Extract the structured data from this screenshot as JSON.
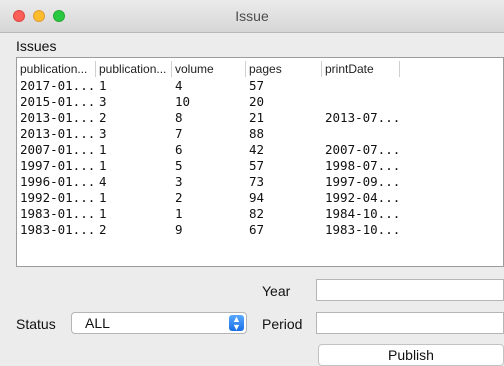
{
  "window": {
    "title": "Issue"
  },
  "section_label": "Issues",
  "table": {
    "columns": [
      "publication...",
      "publication...",
      "volume",
      "pages",
      "printDate"
    ],
    "rows": [
      [
        "2017-01...",
        "1",
        "4",
        "57",
        ""
      ],
      [
        "2015-01...",
        "3",
        "10",
        "20",
        ""
      ],
      [
        "2013-01...",
        "2",
        "8",
        "21",
        "2013-07..."
      ],
      [
        "2013-01...",
        "3",
        "7",
        "88",
        ""
      ],
      [
        "2007-01...",
        "1",
        "6",
        "42",
        "2007-07..."
      ],
      [
        "1997-01...",
        "1",
        "5",
        "57",
        "1998-07..."
      ],
      [
        "1996-01...",
        "4",
        "3",
        "73",
        "1997-09..."
      ],
      [
        "1992-01...",
        "1",
        "2",
        "94",
        "1992-04..."
      ],
      [
        "1983-01...",
        "1",
        "1",
        "82",
        "1984-10..."
      ],
      [
        "1983-01...",
        "2",
        "9",
        "67",
        "1983-10..."
      ]
    ]
  },
  "form": {
    "year_label": "Year",
    "year_value": "",
    "period_label": "Period",
    "period_value": "",
    "status_label": "Status",
    "status_value": "ALL",
    "publish_label": "Publish"
  }
}
